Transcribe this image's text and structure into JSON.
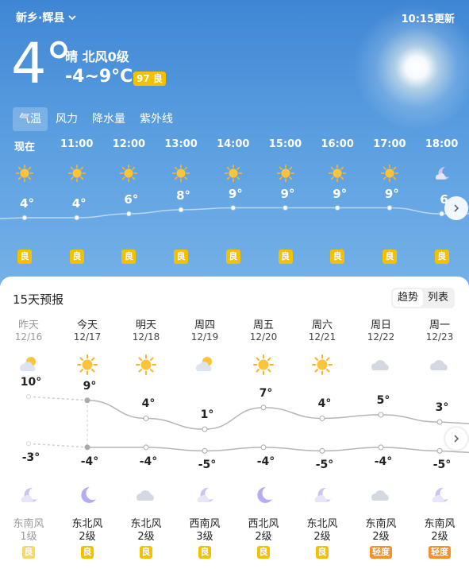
{
  "header": {
    "location": "新乡·辉县",
    "update_time": "10:15更新",
    "current_temp": "4°",
    "weather_desc": "晴  北风0级",
    "temp_range": "-4~9°C",
    "aqi_badge": "97 良"
  },
  "tabs": [
    {
      "label": "气温",
      "active": true
    },
    {
      "label": "风力",
      "active": false
    },
    {
      "label": "降水量",
      "active": false
    },
    {
      "label": "紫外线",
      "active": false
    }
  ],
  "hourly": [
    {
      "time": "现在",
      "temp": 4,
      "temp_label": "4°",
      "icon": "sun-icon",
      "aqi": "良"
    },
    {
      "time": "11:00",
      "temp": 4,
      "temp_label": "4°",
      "icon": "sun-icon",
      "aqi": "良"
    },
    {
      "time": "12:00",
      "temp": 6,
      "temp_label": "6°",
      "icon": "sun-icon",
      "aqi": "良"
    },
    {
      "time": "13:00",
      "temp": 8,
      "temp_label": "8°",
      "icon": "sun-icon",
      "aqi": "良"
    },
    {
      "time": "14:00",
      "temp": 9,
      "temp_label": "9°",
      "icon": "sun-icon",
      "aqi": "良"
    },
    {
      "time": "15:00",
      "temp": 9,
      "temp_label": "9°",
      "icon": "sun-icon",
      "aqi": "良"
    },
    {
      "time": "16:00",
      "temp": 9,
      "temp_label": "9°",
      "icon": "sun-icon",
      "aqi": "良"
    },
    {
      "time": "17:00",
      "temp": 9,
      "temp_label": "9°",
      "icon": "sun-icon",
      "aqi": "良"
    },
    {
      "time": "18:00",
      "temp": 6,
      "temp_label": "6",
      "icon": "moon-icon",
      "aqi": "良"
    }
  ],
  "forecast": {
    "title": "15天预报",
    "switch": [
      {
        "label": "趋势",
        "active": true
      },
      {
        "label": "列表",
        "active": false
      }
    ],
    "days": [
      {
        "name": "昨天",
        "date": "12/16",
        "day_icon": "partly-cloudy-icon",
        "high": 10,
        "high_label": "10°",
        "low": -3,
        "low_label": "-3°",
        "night_icon": "moon-icon",
        "wind_dir": "东南风",
        "wind_lvl": "1级",
        "aqi": "良",
        "aqi_color": "#f2c100",
        "past": true
      },
      {
        "name": "今天",
        "date": "12/17",
        "day_icon": "sun-icon",
        "high": 9,
        "high_label": "9°",
        "low": -4,
        "low_label": "-4°",
        "night_icon": "moon-star-icon",
        "wind_dir": "东北风",
        "wind_lvl": "2级",
        "aqi": "良",
        "aqi_color": "#f2c100",
        "past": false
      },
      {
        "name": "明天",
        "date": "12/18",
        "day_icon": "sun-icon",
        "high": 4,
        "high_label": "4°",
        "low": -4,
        "low_label": "-4°",
        "night_icon": "cloud-icon",
        "wind_dir": "东北风",
        "wind_lvl": "2级",
        "aqi": "良",
        "aqi_color": "#f2c100",
        "past": false
      },
      {
        "name": "周四",
        "date": "12/19",
        "day_icon": "partly-cloudy-icon",
        "high": 1,
        "high_label": "1°",
        "low": -5,
        "low_label": "-5°",
        "night_icon": "moon-icon",
        "wind_dir": "西南风",
        "wind_lvl": "3级",
        "aqi": "良",
        "aqi_color": "#f2c100",
        "past": false
      },
      {
        "name": "周五",
        "date": "12/20",
        "day_icon": "sun-icon",
        "high": 7,
        "high_label": "7°",
        "low": -4,
        "low_label": "-4°",
        "night_icon": "moon-star-icon",
        "wind_dir": "西北风",
        "wind_lvl": "2级",
        "aqi": "良",
        "aqi_color": "#f2c100",
        "past": false
      },
      {
        "name": "周六",
        "date": "12/21",
        "day_icon": "sun-icon",
        "high": 4,
        "high_label": "4°",
        "low": -5,
        "low_label": "-5°",
        "night_icon": "moon-icon",
        "wind_dir": "东北风",
        "wind_lvl": "2级",
        "aqi": "良",
        "aqi_color": "#f2c100",
        "past": false
      },
      {
        "name": "周日",
        "date": "12/22",
        "day_icon": "cloud-icon",
        "high": 5,
        "high_label": "5°",
        "low": -4,
        "low_label": "-4°",
        "night_icon": "cloud-icon",
        "wind_dir": "东南风",
        "wind_lvl": "2级",
        "aqi": "轻度",
        "aqi_color": "#f5912d",
        "past": false
      },
      {
        "name": "周一",
        "date": "12/23",
        "day_icon": "cloud-icon",
        "high": 3,
        "high_label": "3°",
        "low": -5,
        "low_label": "-5°",
        "night_icon": "moon-icon",
        "wind_dir": "东南风",
        "wind_lvl": "2级",
        "aqi": "轻度",
        "aqi_color": "#f5912d",
        "past": false
      }
    ]
  }
}
